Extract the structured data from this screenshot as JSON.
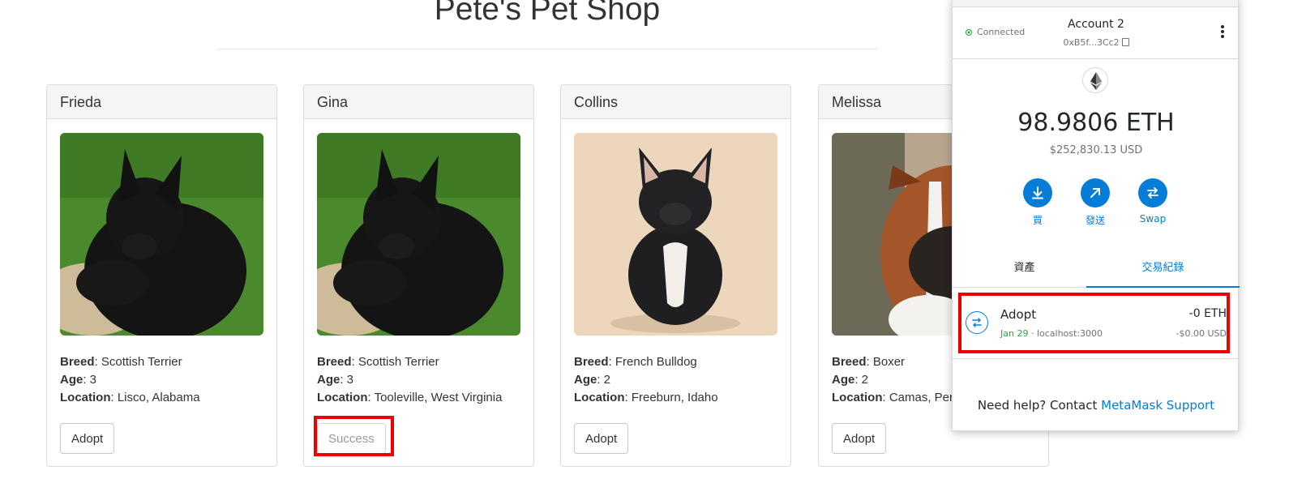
{
  "page": {
    "title": "Pete's Pet Shop"
  },
  "pets": [
    {
      "name": "Frieda",
      "breed_label": "Breed",
      "breed": ": Scottish Terrier",
      "age_label": "Age",
      "age": ": 3",
      "location_label": "Location",
      "location": ": Lisco, Alabama",
      "button": "Adopt",
      "photo": "scottish-terrier-photo"
    },
    {
      "name": "Gina",
      "breed_label": "Breed",
      "breed": ": Scottish Terrier",
      "age_label": "Age",
      "age": ": 3",
      "location_label": "Location",
      "location": ": Tooleville, West Virginia",
      "button": "Success",
      "photo": "scottish-terrier-photo"
    },
    {
      "name": "Collins",
      "breed_label": "Breed",
      "breed": ": French Bulldog",
      "age_label": "Age",
      "age": ": 2",
      "location_label": "Location",
      "location": ": Freeburn, Idaho",
      "button": "Adopt",
      "photo": "french-bulldog-photo"
    },
    {
      "name": "Melissa",
      "breed_label": "Breed",
      "breed": ": Boxer",
      "age_label": "Age",
      "age": ": 2",
      "location_label": "Location",
      "location": ": Camas, Per",
      "button": "Adopt",
      "photo": "boxer-photo"
    }
  ],
  "metamask": {
    "connection_status": "Connected",
    "account_name": "Account 2",
    "account_address": "0xB5f...3Cc2",
    "balance": "98.9806 ETH",
    "balance_fiat": "$252,830.13 USD",
    "actions": [
      {
        "label": "買",
        "icon": "download-arrow-icon"
      },
      {
        "label": "發送",
        "icon": "send-arrow-icon"
      },
      {
        "label": "Swap",
        "icon": "swap-arrows-icon"
      }
    ],
    "tabs": [
      {
        "label": "資產",
        "active": false
      },
      {
        "label": "交易紀錄",
        "active": true
      }
    ],
    "transaction": {
      "title": "Adopt",
      "date": "Jan 29",
      "origin": " · localhost:3000",
      "amount": "-0 ETH",
      "amount_fiat": "-$0.00 USD"
    },
    "help_text": "Need help? Contact ",
    "help_link": "MetaMask Support",
    "accent_color": "#037dd6"
  },
  "highlight_color": "#ee0000"
}
